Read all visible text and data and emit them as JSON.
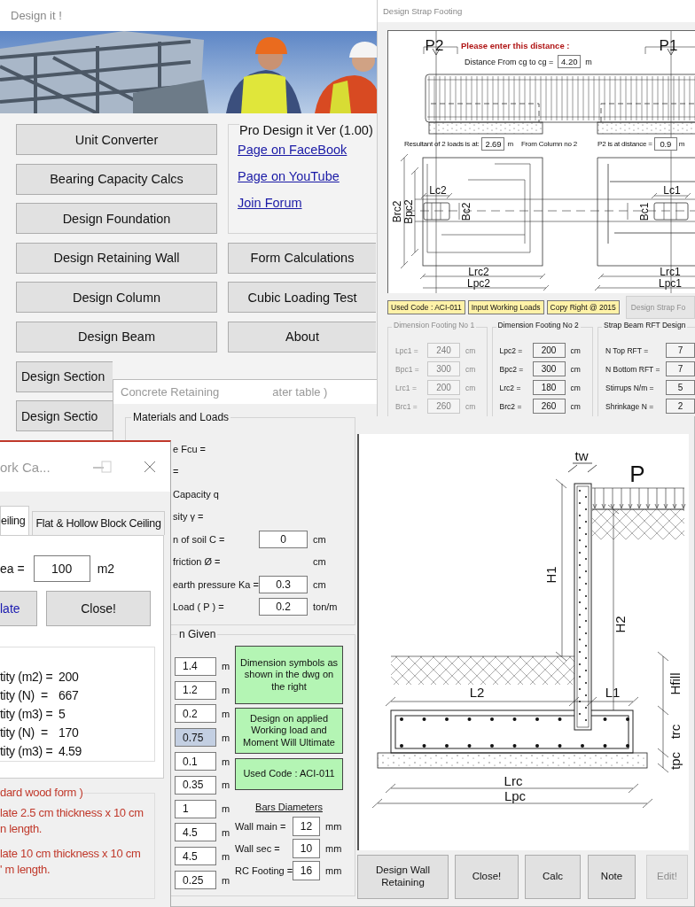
{
  "main_window": {
    "title": "Design it !",
    "photo": {
      "kind": "picture"
    },
    "left_buttons": [
      "Unit Converter",
      "Bearing Capacity Calcs",
      "Design Foundation",
      "Design Retaining Wall",
      "Design Column",
      "Design Beam",
      "Design Section",
      "Design Sectio"
    ],
    "right_buttons": [
      "Form Calculations",
      "Cubic Loading Test",
      "About"
    ],
    "info_group": {
      "title": "Pro Design it Ver (1.00)",
      "links": [
        "Page on FaceBook",
        "Page on YouTube",
        "Join Forum"
      ]
    }
  },
  "retaining_window": {
    "title_parts": [
      "Concrete Retaining",
      "ater table )"
    ],
    "materials": {
      "title": "Materials and Loads",
      "rows": [
        {
          "label": "e Fcu ="
        },
        {
          "label": "="
        },
        {
          "label": "Capacity q"
        },
        {
          "label": "sity γ ="
        },
        {
          "label": "n of soil C =",
          "value": "0",
          "unit": "cm"
        },
        {
          "label": "friction Ø =",
          "unit": "cm"
        },
        {
          "label": "earth pressure Ka =",
          "value": "0.3",
          "unit": "cm"
        },
        {
          "label": "Load ( P ) =",
          "value": "0.2",
          "unit": "ton/m"
        }
      ]
    },
    "dims": {
      "title": "n Given",
      "rows": [
        {
          "value": "1.4",
          "unit": "m",
          "selected": false
        },
        {
          "value": "1.2",
          "unit": "m",
          "selected": false
        },
        {
          "value": "0.2",
          "unit": "m",
          "selected": false
        },
        {
          "value": "0.75",
          "unit": "m",
          "selected": true
        },
        {
          "value": "0.1",
          "unit": "m",
          "selected": false
        },
        {
          "value": "0.35",
          "unit": "m",
          "selected": false
        },
        {
          "value": "1",
          "unit": "m",
          "selected": false
        },
        {
          "value": "4.5",
          "unit": "m",
          "selected": false
        },
        {
          "value": "4.5",
          "unit": "m",
          "selected": false
        },
        {
          "value": "0.25",
          "unit": "m",
          "selected": false
        }
      ]
    },
    "notes": [
      "Dimension symbols as shown in the dwg on the right",
      "Design on applied Working load and Moment Will Ultimate",
      "Used Code : ACI-011"
    ],
    "bars": {
      "title": "Bars Diameters",
      "rows": [
        {
          "label": "Wall main =",
          "value": "12",
          "unit": "mm"
        },
        {
          "label": "Wall sec =",
          "value": "10",
          "unit": "mm"
        },
        {
          "label": "RC Footing =",
          "value": "16",
          "unit": "mm"
        }
      ]
    },
    "drawing_labels": {
      "tw": "tw",
      "p": "P",
      "h1": "H1",
      "h2": "H2",
      "l2": "L2",
      "l1": "L1",
      "hfill": "Hfill",
      "trc": "trc",
      "tpc": "tpc",
      "lrc": "Lrc",
      "lpc": "Lpc"
    },
    "buttons": [
      {
        "label": "Design Wall Retaining",
        "disabled": false
      },
      {
        "label": "Close!",
        "disabled": false
      },
      {
        "label": "Calc",
        "disabled": false
      },
      {
        "label": "Note",
        "disabled": false
      },
      {
        "label": "Edit!",
        "disabled": true
      }
    ]
  },
  "strap_window": {
    "title": "Design Strap Footing",
    "prompt": "Please enter this distance :",
    "distance": {
      "label": "Distance From cg to cg =",
      "value": "4.20",
      "unit": "m"
    },
    "resultant": {
      "label": "Resultant of 2 loads is at:",
      "value": "2.69",
      "unit": "m",
      "note": "From Column no 2"
    },
    "p2_distance": {
      "label": "P2 is at distance =",
      "value": "0.9",
      "unit": "m"
    },
    "drawing_labels": {
      "p2": "P2",
      "p1": "P1",
      "lc2": "Lc2",
      "bc2": "Bc2",
      "brc2": "Brc2",
      "bpc2": "Bpc2",
      "lrc2": "Lrc2",
      "lpc2": "Lpc2",
      "lc1": "Lc1",
      "bc1": "Bc1",
      "lrc1": "Lrc1",
      "lpc1": "Lpc1"
    },
    "tags": [
      "Used Code : ACI-011",
      "Input Working Loads",
      "Copy Right @ 2015"
    ],
    "design_button": {
      "label": "Design Strap Fo",
      "disabled": true
    },
    "groups": [
      {
        "title": "Dimension Footing No 1",
        "disabled": true,
        "rows": [
          {
            "label": "Lpc1 =",
            "value": "240",
            "unit": "cm"
          },
          {
            "label": "Bpc1 =",
            "value": "300",
            "unit": "cm"
          },
          {
            "label": "Lrc1 =",
            "value": "200",
            "unit": "cm"
          },
          {
            "label": "Brc1 =",
            "value": "260",
            "unit": "cm"
          }
        ]
      },
      {
        "title": "Dimension Footing No 2",
        "disabled": false,
        "rows": [
          {
            "label": "Lpc2 =",
            "value": "200",
            "unit": "cm"
          },
          {
            "label": "Bpc2 =",
            "value": "300",
            "unit": "cm"
          },
          {
            "label": "Lrc2 =",
            "value": "180",
            "unit": "cm"
          },
          {
            "label": "Brc2 =",
            "value": "260",
            "unit": "cm"
          }
        ]
      },
      {
        "title": "Strap Beam RFT Design",
        "disabled": false,
        "rows": [
          {
            "label": "N Top RFT =",
            "value": "7"
          },
          {
            "label": "N Bottom RFT =",
            "value": "7"
          },
          {
            "label": "Stirrups N/m =",
            "value": "5"
          },
          {
            "label": "Shrinkage N =",
            "value": "2"
          }
        ]
      }
    ]
  },
  "forms_window": {
    "title": "ork Ca...",
    "tabs": [
      {
        "label": "eiling",
        "selected": true
      },
      {
        "label": "Flat & Hollow Block Ceiling",
        "selected": false
      }
    ],
    "area": {
      "label": "ea =",
      "value": "100",
      "unit": "m2"
    },
    "buttons": [
      {
        "label": "late",
        "focused": true
      },
      {
        "label": "Close!",
        "focused": false
      }
    ],
    "results": [
      {
        "label": "tity (m2) =",
        "value": "200"
      },
      {
        "label": "tity (N)  =",
        "value": "667"
      },
      {
        "label": "tity (m3) =",
        "value": "5"
      },
      {
        "label": "tity (N)  =",
        "value": "170"
      },
      {
        "label": "tity (m3) =",
        "value": "4.59"
      }
    ],
    "notes": {
      "title": "dard wood form )",
      "lines": [
        "late 2.5 cm thickness x 10 cm",
        "n length.",
        "late 10 cm thickness x 10 cm",
        "' m length."
      ]
    }
  }
}
